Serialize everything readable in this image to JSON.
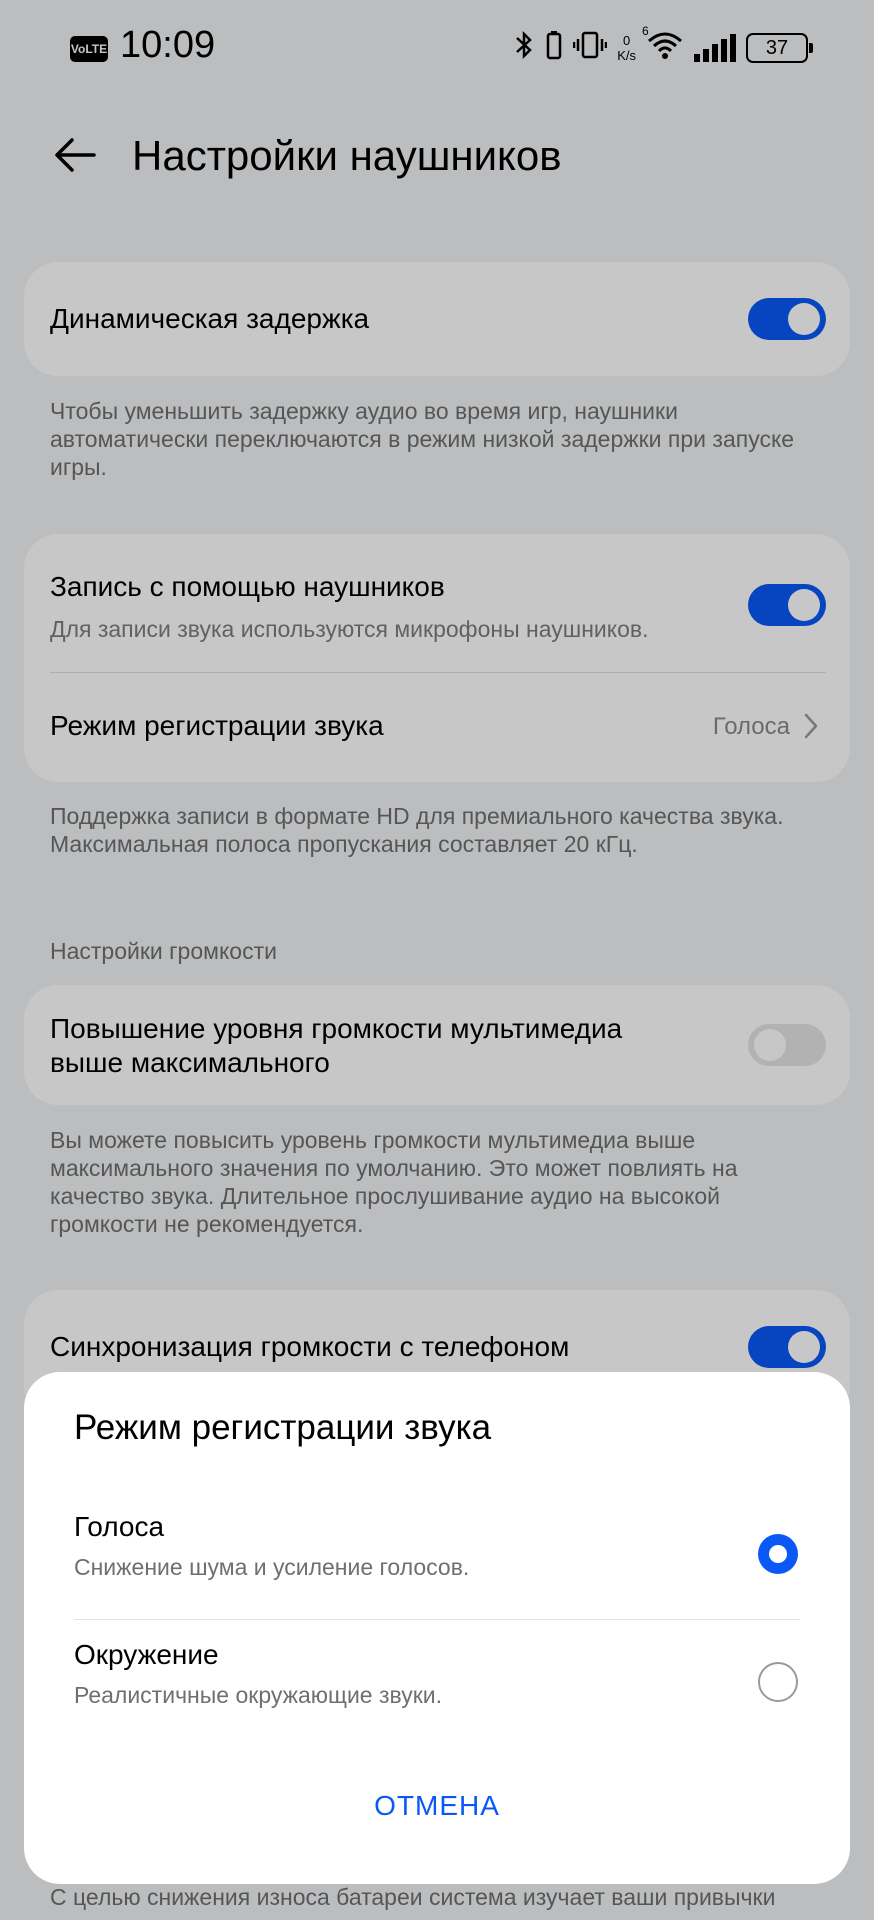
{
  "status_bar": {
    "volte": "VoLTE",
    "time": "10:09",
    "net_speed_value": "0",
    "net_speed_unit": "K/s",
    "network_type": "6",
    "battery": "37"
  },
  "header": {
    "title": "Настройки наушников"
  },
  "dynamic_latency": {
    "title": "Динамическая задержка",
    "enabled": true,
    "description": "Чтобы уменьшить задержку аудио во время игр, наушники автоматически переключаются в режим низкой задержки при запуске игры."
  },
  "recording": {
    "title": "Запись с помощью наушников",
    "subtitle": "Для записи звука используются микрофоны наушников.",
    "enabled": true,
    "mode_label": "Режим регистрации звука",
    "mode_value": "Голоса",
    "description": "Поддержка записи в формате HD для премиального качества звука. Максимальная полоса пропускания составляет 20 кГц."
  },
  "volume_section": {
    "label": "Настройки громкости",
    "boost_title": "Повышение уровня громкости мультимедиа выше максимального",
    "boost_enabled": false,
    "boost_description": "Вы можете повысить уровень громкости мультимедиа выше максимального значения по умолчанию. Это может повлиять на качество звука. Длительное прослушивание аудио на высокой громкости не рекомендуется.",
    "sync_title": "Синхронизация громкости с телефоном",
    "sync_enabled": true
  },
  "bottom_text": "С целью снижения износа батареи система изучает ваши привычки",
  "dialog": {
    "title": "Режим регистрации звука",
    "options": [
      {
        "title": "Голоса",
        "subtitle": "Снижение шума и усиление голосов.",
        "selected": true
      },
      {
        "title": "Окружение",
        "subtitle": "Реалистичные окружающие звуки.",
        "selected": false
      }
    ],
    "cancel_label": "ОТМЕНА"
  },
  "colors": {
    "accent": "#0a59f7",
    "background": "#f1f3f5",
    "card": "#ffffff",
    "secondary_text": "#6f6f6f"
  }
}
